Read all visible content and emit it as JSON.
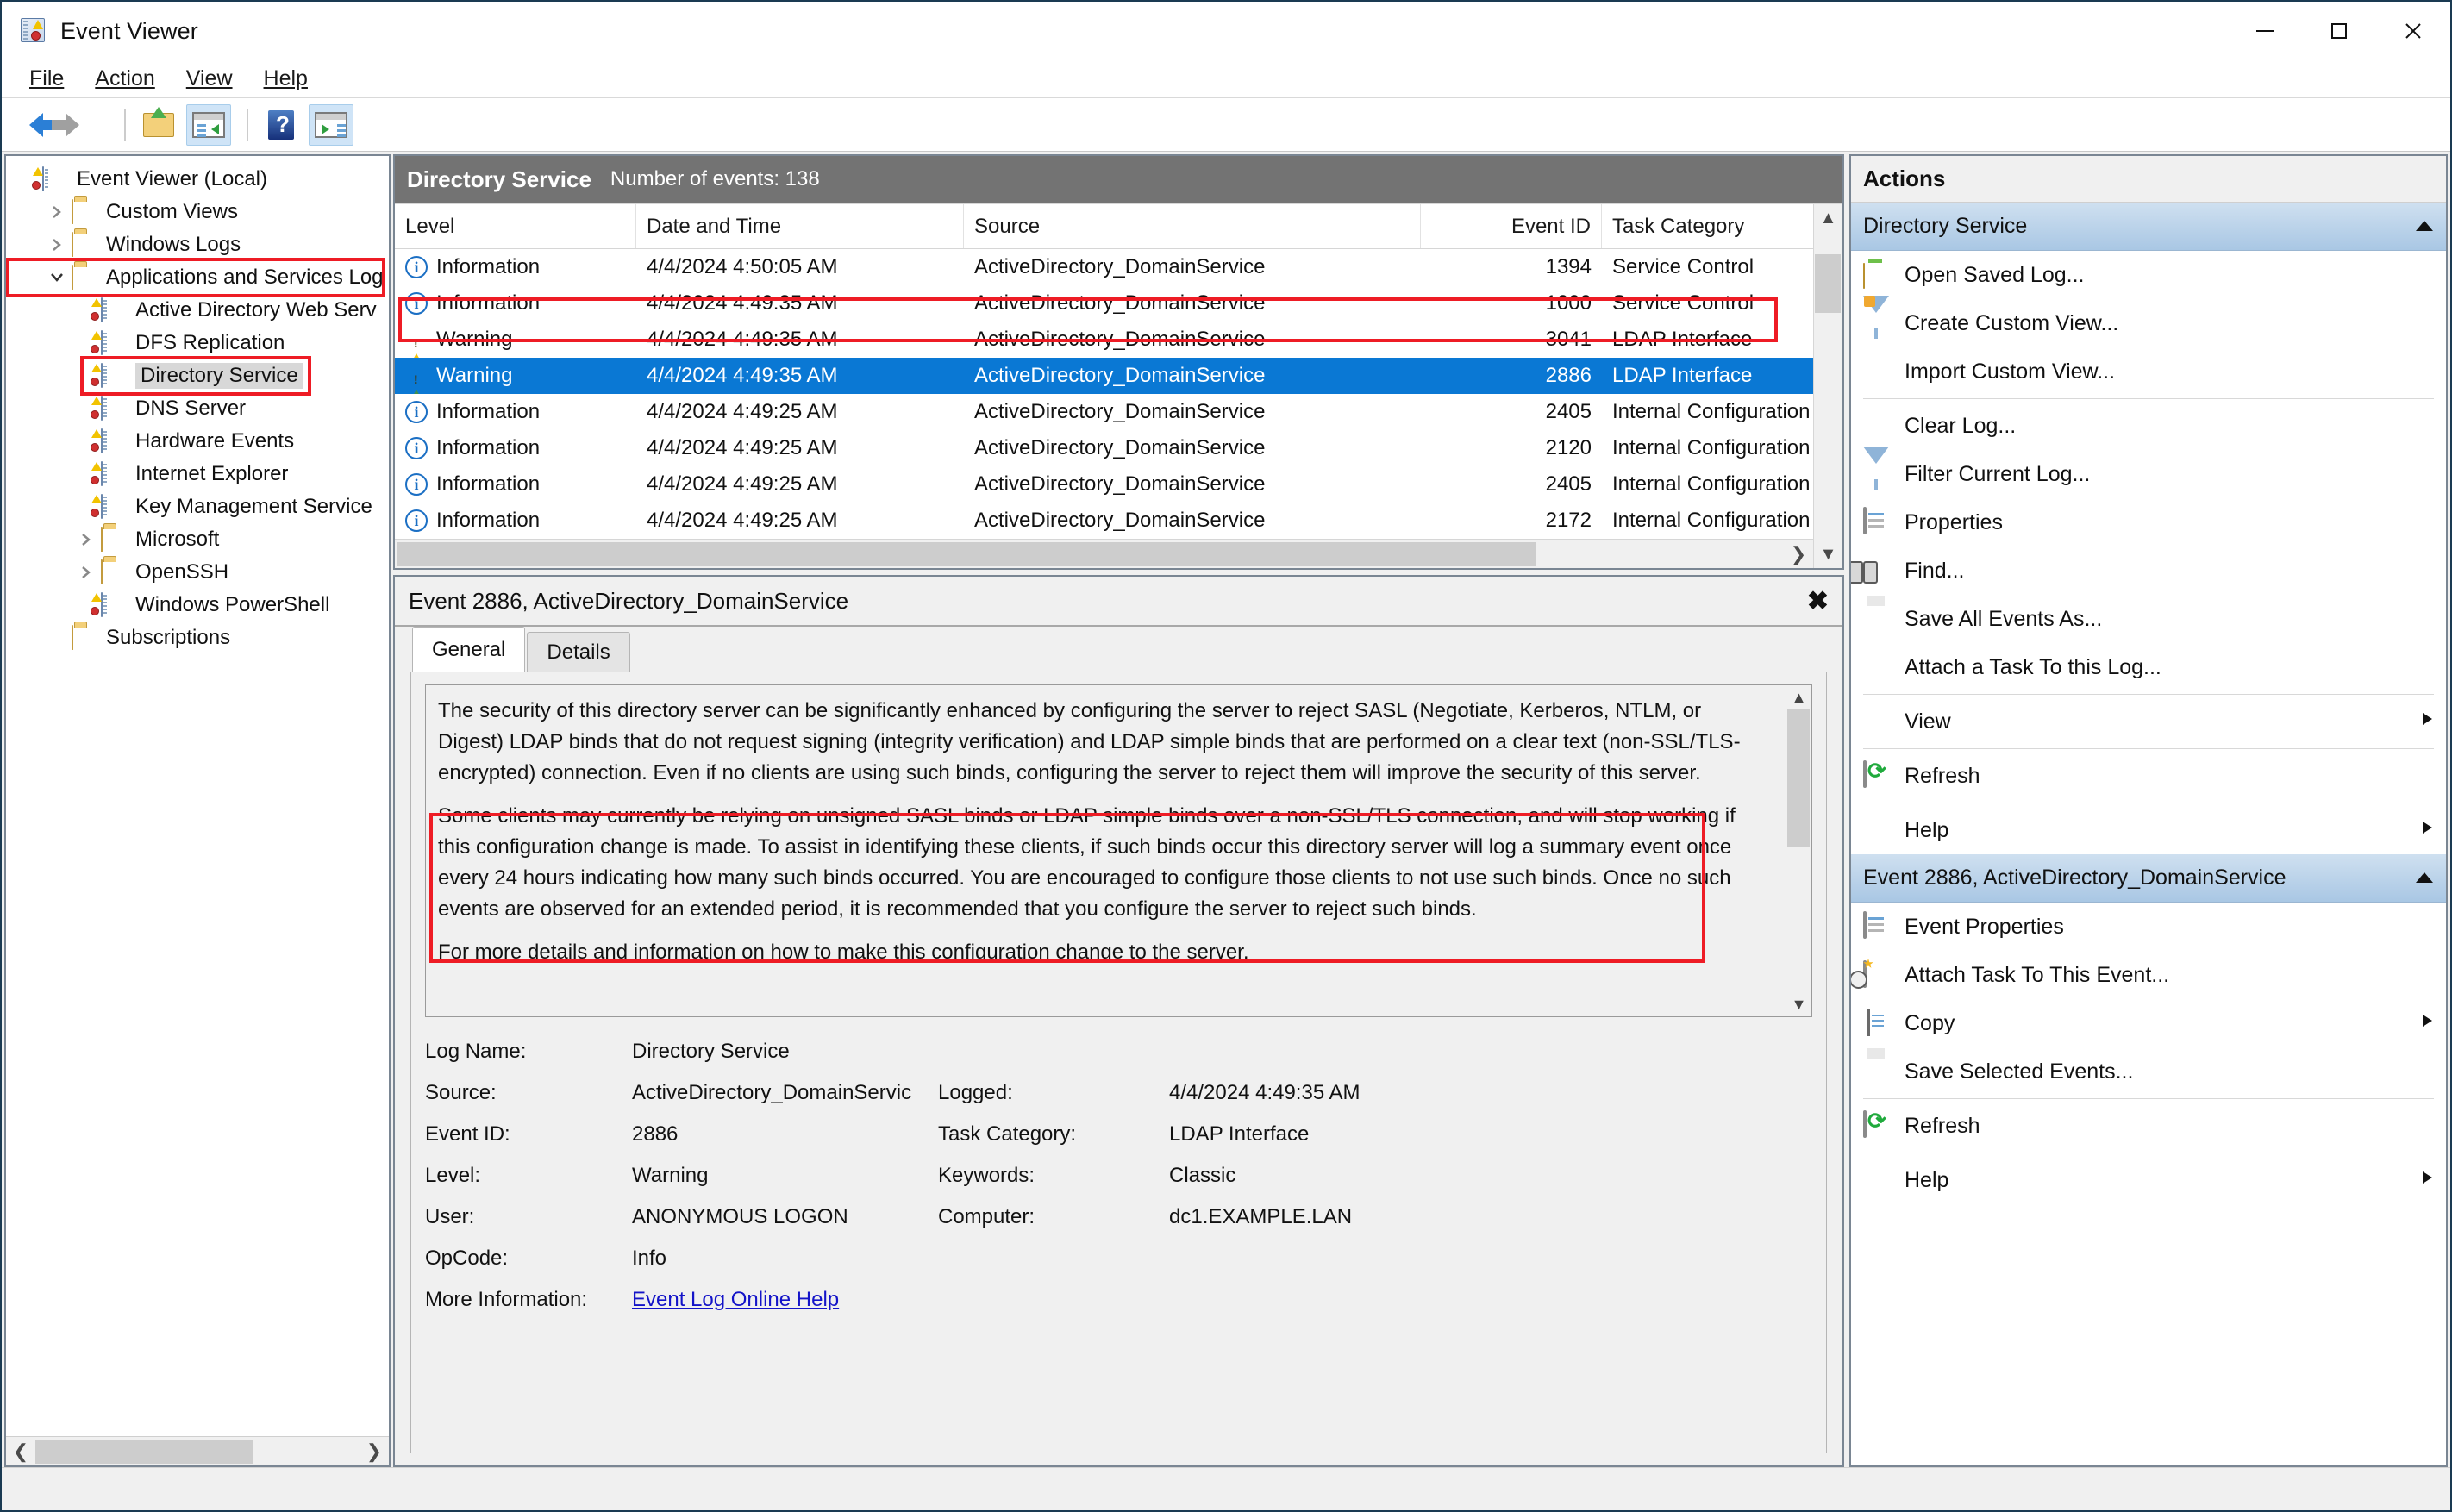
{
  "window": {
    "title": "Event Viewer",
    "icon": "event-viewer-icon",
    "controls": {
      "minimize": "—",
      "maximize": "☐",
      "close": "✕"
    }
  },
  "menubar": {
    "items": [
      "File",
      "Action",
      "View",
      "Help"
    ]
  },
  "toolbar": {
    "items": [
      {
        "name": "back-button",
        "icon": "back-arrow-icon",
        "active": false
      },
      {
        "name": "forward-button",
        "icon": "forward-arrow-icon",
        "active": false
      },
      {
        "name": "up-one-level-button",
        "icon": "folder-up-icon",
        "active": false
      },
      {
        "name": "show-hide-console-tree-button",
        "icon": "console-tree-icon",
        "active": true
      },
      {
        "name": "help-button",
        "icon": "help-icon",
        "active": false
      },
      {
        "name": "show-hide-action-pane-button",
        "icon": "action-pane-icon",
        "active": true
      }
    ]
  },
  "tree": {
    "items": [
      {
        "label": "Event Viewer (Local)",
        "level": 0,
        "twisty": "none",
        "icon": "event-log-icon",
        "selected": false
      },
      {
        "label": "Custom Views",
        "level": 1,
        "twisty": "collapsed",
        "icon": "folder-filter-icon",
        "selected": false
      },
      {
        "label": "Windows Logs",
        "level": 1,
        "twisty": "collapsed",
        "icon": "folder-windows-icon",
        "selected": false
      },
      {
        "label": "Applications and Services Log",
        "level": 1,
        "twisty": "expanded",
        "icon": "folder-open-icon",
        "selected": false,
        "annotated": true
      },
      {
        "label": "Active Directory Web Serv",
        "level": 2,
        "twisty": "none",
        "icon": "event-log-icon",
        "selected": false
      },
      {
        "label": "DFS Replication",
        "level": 2,
        "twisty": "none",
        "icon": "event-log-icon",
        "selected": false
      },
      {
        "label": "Directory Service",
        "level": 2,
        "twisty": "none",
        "icon": "event-log-icon",
        "selected": true,
        "annotated": true
      },
      {
        "label": "DNS Server",
        "level": 2,
        "twisty": "none",
        "icon": "event-log-icon",
        "selected": false
      },
      {
        "label": "Hardware Events",
        "level": 2,
        "twisty": "none",
        "icon": "event-log-icon",
        "selected": false
      },
      {
        "label": "Internet Explorer",
        "level": 2,
        "twisty": "none",
        "icon": "event-log-icon",
        "selected": false
      },
      {
        "label": "Key Management Service",
        "level": 2,
        "twisty": "none",
        "icon": "event-log-icon",
        "selected": false
      },
      {
        "label": "Microsoft",
        "level": 2,
        "twisty": "collapsed",
        "icon": "folder-icon",
        "selected": false
      },
      {
        "label": "OpenSSH",
        "level": 2,
        "twisty": "collapsed",
        "icon": "folder-icon",
        "selected": false
      },
      {
        "label": "Windows PowerShell",
        "level": 2,
        "twisty": "none",
        "icon": "event-log-icon",
        "selected": false
      },
      {
        "label": "Subscriptions",
        "level": 1,
        "twisty": "none",
        "icon": "folder-subscriptions-icon",
        "selected": false
      }
    ]
  },
  "list_panel": {
    "title": "Directory Service",
    "subtitle": "Number of events: 138",
    "columns": [
      "Level",
      "Date and Time",
      "Source",
      "Event ID",
      "Task Category"
    ],
    "rows": [
      {
        "level": "Information",
        "level_icon": "information-icon",
        "date": "4/4/2024 4:50:05 AM",
        "source": "ActiveDirectory_DomainService",
        "event_id": "1394",
        "task": "Service Control",
        "selected": false
      },
      {
        "level": "Information",
        "level_icon": "information-icon",
        "date": "4/4/2024 4:49:35 AM",
        "source": "ActiveDirectory_DomainService",
        "event_id": "1000",
        "task": "Service Control",
        "selected": false
      },
      {
        "level": "Warning",
        "level_icon": "warning-icon",
        "date": "4/4/2024 4:49:35 AM",
        "source": "ActiveDirectory_DomainService",
        "event_id": "3041",
        "task": "LDAP Interface",
        "selected": false
      },
      {
        "level": "Warning",
        "level_icon": "warning-icon",
        "date": "4/4/2024 4:49:35 AM",
        "source": "ActiveDirectory_DomainService",
        "event_id": "2886",
        "task": "LDAP Interface",
        "selected": true
      },
      {
        "level": "Information",
        "level_icon": "information-icon",
        "date": "4/4/2024 4:49:25 AM",
        "source": "ActiveDirectory_DomainService",
        "event_id": "2405",
        "task": "Internal Configuration",
        "selected": false
      },
      {
        "level": "Information",
        "level_icon": "information-icon",
        "date": "4/4/2024 4:49:25 AM",
        "source": "ActiveDirectory_DomainService",
        "event_id": "2120",
        "task": "Internal Configuration",
        "selected": false
      },
      {
        "level": "Information",
        "level_icon": "information-icon",
        "date": "4/4/2024 4:49:25 AM",
        "source": "ActiveDirectory_DomainService",
        "event_id": "2405",
        "task": "Internal Configuration",
        "selected": false
      },
      {
        "level": "Information",
        "level_icon": "information-icon",
        "date": "4/4/2024 4:49:25 AM",
        "source": "ActiveDirectory_DomainService",
        "event_id": "2172",
        "task": "Internal Configuration",
        "selected": false
      }
    ]
  },
  "detail": {
    "header": "Event 2886, ActiveDirectory_DomainService",
    "close_icon": "close-icon",
    "tabs": [
      {
        "label": "General",
        "active": true
      },
      {
        "label": "Details",
        "active": false
      }
    ],
    "description_paragraph_1": "The security of this directory server can be significantly enhanced by configuring the server to reject SASL (Negotiate, Kerberos, NTLM, or Digest) LDAP binds that do not request signing (integrity verification) and LDAP simple binds that are performed on a clear text (non-SSL/TLS-encrypted) connection.  Even if no clients are using such binds, configuring the server to reject them will improve the security of this server.",
    "description_paragraph_2": "Some clients may currently be relying on unsigned SASL binds or LDAP simple binds over a non-SSL/TLS connection, and will stop working if this configuration change is made.  To assist in identifying these clients, if such binds occur this directory server will log a summary event once every 24 hours indicating how many such binds occurred.  You are encouraged to configure those clients to not use such binds.  Once no such events are observed for an extended period, it is recommended that you configure the server to reject such binds.",
    "description_paragraph_3": "For more details and information on how to make this configuration change to the server,",
    "fields": {
      "log_name_label": "Log Name:",
      "log_name_value": "Directory Service",
      "source_label": "Source:",
      "source_value": "ActiveDirectory_DomainServic",
      "logged_label": "Logged:",
      "logged_value": "4/4/2024 4:49:35 AM",
      "event_id_label": "Event ID:",
      "event_id_value": "2886",
      "task_category_label": "Task Category:",
      "task_category_value": "LDAP Interface",
      "level_label": "Level:",
      "level_value": "Warning",
      "keywords_label": "Keywords:",
      "keywords_value": "Classic",
      "user_label": "User:",
      "user_value": "ANONYMOUS LOGON",
      "computer_label": "Computer:",
      "computer_value": "dc1.EXAMPLE.LAN",
      "opcode_label": "OpCode:",
      "opcode_value": "Info",
      "more_info_label": "More Information:",
      "more_info_link": "Event Log Online Help"
    }
  },
  "actions": {
    "title": "Actions",
    "groups": [
      {
        "header": "Directory Service",
        "collapse_icon": "chevron-up-icon",
        "items": [
          {
            "label": "Open Saved Log...",
            "icon": "open-saved-log-icon",
            "submenu": false,
            "sep_after": false
          },
          {
            "label": "Create Custom View...",
            "icon": "create-custom-view-icon",
            "submenu": false,
            "sep_after": false
          },
          {
            "label": "Import Custom View...",
            "icon": "none",
            "submenu": false,
            "sep_after": true
          },
          {
            "label": "Clear Log...",
            "icon": "none",
            "submenu": false,
            "sep_after": false
          },
          {
            "label": "Filter Current Log...",
            "icon": "filter-icon",
            "submenu": false,
            "sep_after": false
          },
          {
            "label": "Properties",
            "icon": "properties-icon",
            "submenu": false,
            "sep_after": false
          },
          {
            "label": "Find...",
            "icon": "find-icon",
            "submenu": false,
            "sep_after": false
          },
          {
            "label": "Save All Events As...",
            "icon": "save-icon",
            "submenu": false,
            "sep_after": false
          },
          {
            "label": "Attach a Task To this Log...",
            "icon": "none",
            "submenu": false,
            "sep_after": true
          },
          {
            "label": "View",
            "icon": "none",
            "submenu": true,
            "sep_after": true
          },
          {
            "label": "Refresh",
            "icon": "refresh-icon",
            "submenu": false,
            "sep_after": true
          },
          {
            "label": "Help",
            "icon": "help-icon",
            "submenu": true,
            "sep_after": false
          }
        ]
      },
      {
        "header": "Event 2886, ActiveDirectory_DomainService",
        "collapse_icon": "chevron-up-icon",
        "items": [
          {
            "label": "Event Properties",
            "icon": "properties-icon",
            "submenu": false,
            "sep_after": false
          },
          {
            "label": "Attach Task To This Event...",
            "icon": "attach-task-icon",
            "submenu": false,
            "sep_after": false
          },
          {
            "label": "Copy",
            "icon": "copy-icon",
            "submenu": true,
            "sep_after": false
          },
          {
            "label": "Save Selected Events...",
            "icon": "save-icon",
            "submenu": false,
            "sep_after": true
          },
          {
            "label": "Refresh",
            "icon": "refresh-icon",
            "submenu": false,
            "sep_after": true
          },
          {
            "label": "Help",
            "icon": "help-icon",
            "submenu": true,
            "sep_after": false
          }
        ]
      }
    ]
  },
  "colors": {
    "selection_blue": "#0a78d4",
    "annotation_red": "#ee1c25",
    "panel_header_gray": "#737373",
    "group_header_blue": "#a9c7e4",
    "link_blue": "#1414c8"
  }
}
